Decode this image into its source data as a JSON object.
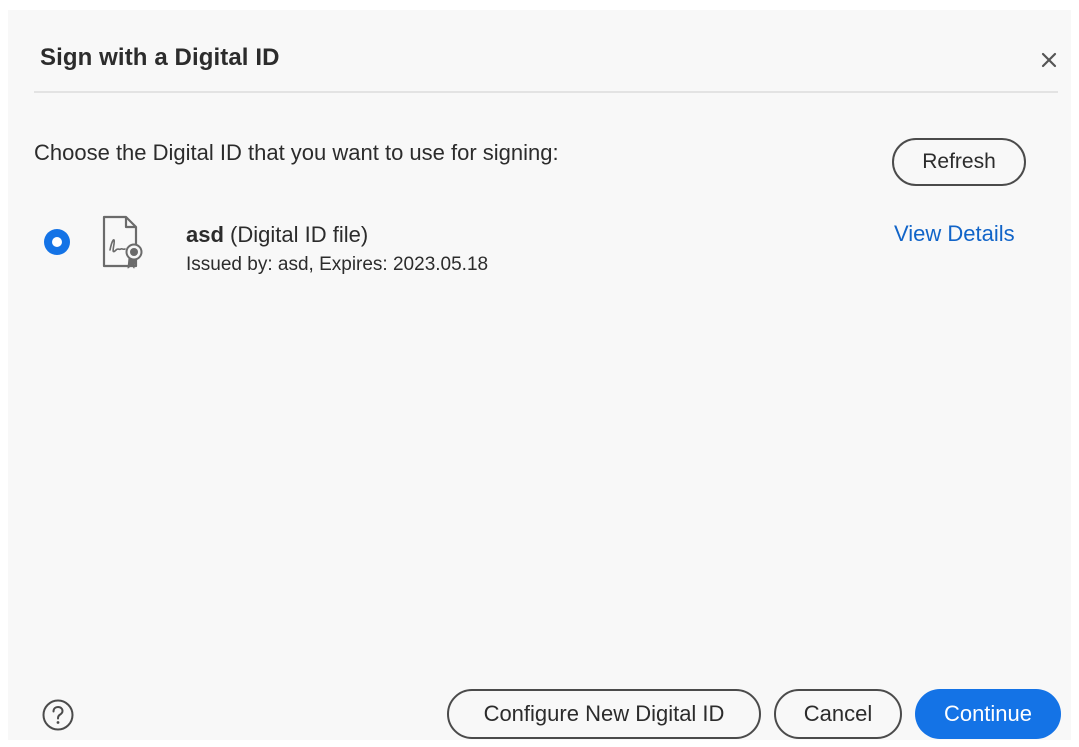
{
  "dialog": {
    "title": "Sign with a Digital ID",
    "close_icon": "close-icon"
  },
  "instruction": "Choose the Digital ID that you want to use for signing:",
  "refresh_label": "Refresh",
  "digital_ids": [
    {
      "name": "asd",
      "type": "(Digital ID file)",
      "issued": "Issued by: asd, Expires: 2023.05.18",
      "selected": true,
      "icon": "certificate-file-icon",
      "view_details_label": "View Details"
    }
  ],
  "footer": {
    "help_icon": "help-icon",
    "configure_label": "Configure New Digital ID",
    "cancel_label": "Cancel",
    "continue_label": "Continue"
  },
  "colors": {
    "accent": "#1473e6",
    "link": "#1164c8",
    "background": "#f8f8f8",
    "text": "#2c2c2c"
  }
}
